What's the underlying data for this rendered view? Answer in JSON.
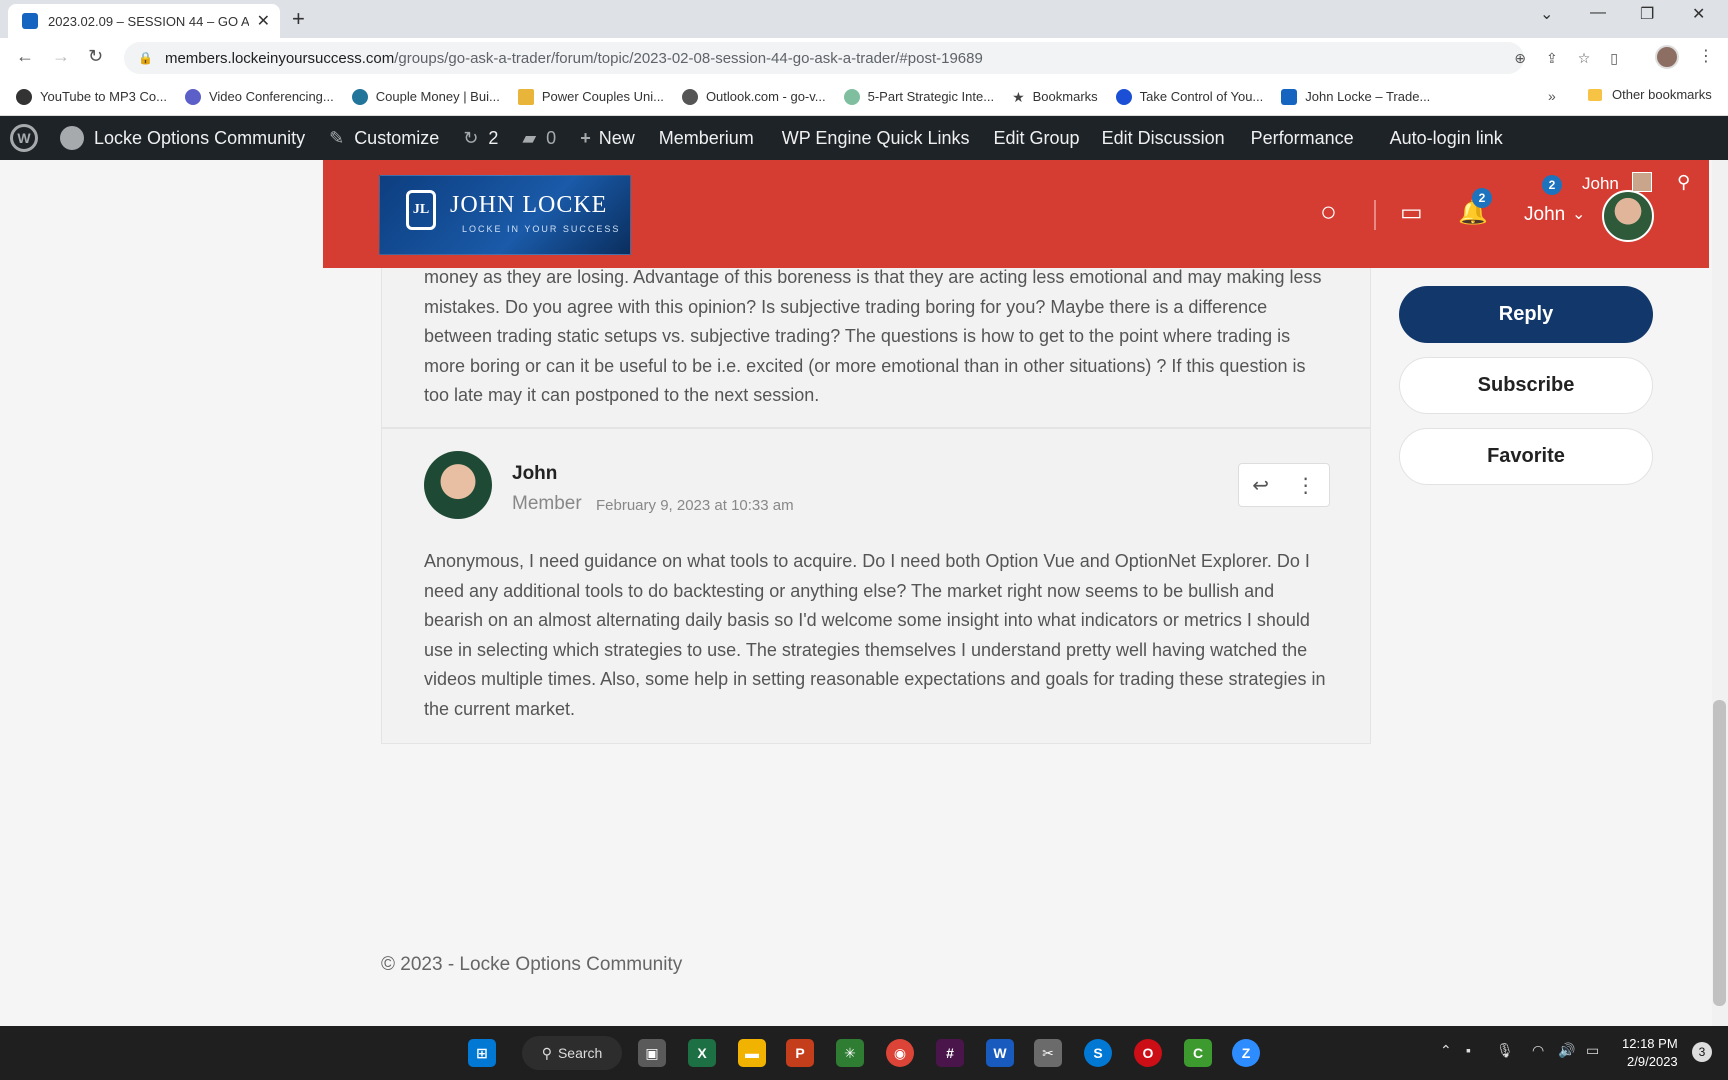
{
  "browser": {
    "tab_title": "2023.02.09 – SESSION 44 – GO A",
    "url_host": "members.lockeinyoursuccess.com",
    "url_path": "/groups/go-ask-a-trader/forum/topic/2023-02-08-session-44-go-ask-a-trader/#post-19689",
    "bookmarks": [
      {
        "label": "YouTube to MP3 Co...",
        "color": "#333333"
      },
      {
        "label": "Video Conferencing...",
        "color": "#5b5fc7"
      },
      {
        "label": "Couple Money | Bui...",
        "color": "#21759b"
      },
      {
        "label": "Power Couples Uni...",
        "color": "#e8b53a"
      },
      {
        "label": "Outlook.com - go-v...",
        "color": "#555555"
      },
      {
        "label": "5-Part Strategic Inte...",
        "color": "#7fbfa0"
      },
      {
        "label": "Bookmarks",
        "color": "#444444"
      },
      {
        "label": "Take Control of You...",
        "color": "#1a4fd6"
      },
      {
        "label": "John Locke – Trade...",
        "color": "#1565c0"
      }
    ],
    "other_bookmarks": "Other bookmarks",
    "more": "»"
  },
  "adminbar": {
    "site_name": "Locke Options Community",
    "customize": "Customize",
    "updates_count": "2",
    "comments_count": "0",
    "new": "New",
    "items": [
      "Memberium",
      "WP Engine Quick Links",
      "Edit Group",
      "Edit Discussion",
      "Performance",
      "Auto-login link"
    ]
  },
  "header": {
    "logo_initials": "JL",
    "logo_name": "JOHN LOCKE",
    "logo_tagline": "LOCKE IN YOUR SUCCESS",
    "notif_badge": "2",
    "user_name": "John",
    "topright_badge": "2",
    "topright_user": "John"
  },
  "post1": {
    "text": "money as they are losing. Advantage of this boreness is that they are acting less emotional and may making less mistakes. Do you agree with this opinion? Is subjective trading boring for you? Maybe there is a difference between trading static setups vs. subjective trading? The questions is how to get to the point where trading is more boring or can it be useful to be i.e. excited (or more emotional than in other situations) ? If this question is too late may it can postponed to the next session."
  },
  "post2": {
    "author": "John",
    "role": "Member",
    "date": "February 9, 2023 at 10:33 am",
    "text": "Anonymous, I need guidance on what tools to acquire. Do I need both Option Vue and OptionNet Explorer. Do I need any additional tools to do backtesting or anything else? The market right now seems to be bullish and bearish on an almost alternating daily basis so I'd welcome some insight into what indicators or metrics I should use in selecting which strategies to use. The strategies themselves I understand pretty well having watched the videos multiple times. Also, some help in setting reasonable expectations and goals for trading these strategies in the current market."
  },
  "sidebar": {
    "reply": "Reply",
    "subscribe": "Subscribe",
    "favorite": "Favorite"
  },
  "footer": {
    "copyright": "© 2023 - Locke Options Community"
  },
  "taskbar": {
    "search": "Search",
    "time": "12:18 PM",
    "date": "2/9/2023",
    "notif_count": "3"
  }
}
